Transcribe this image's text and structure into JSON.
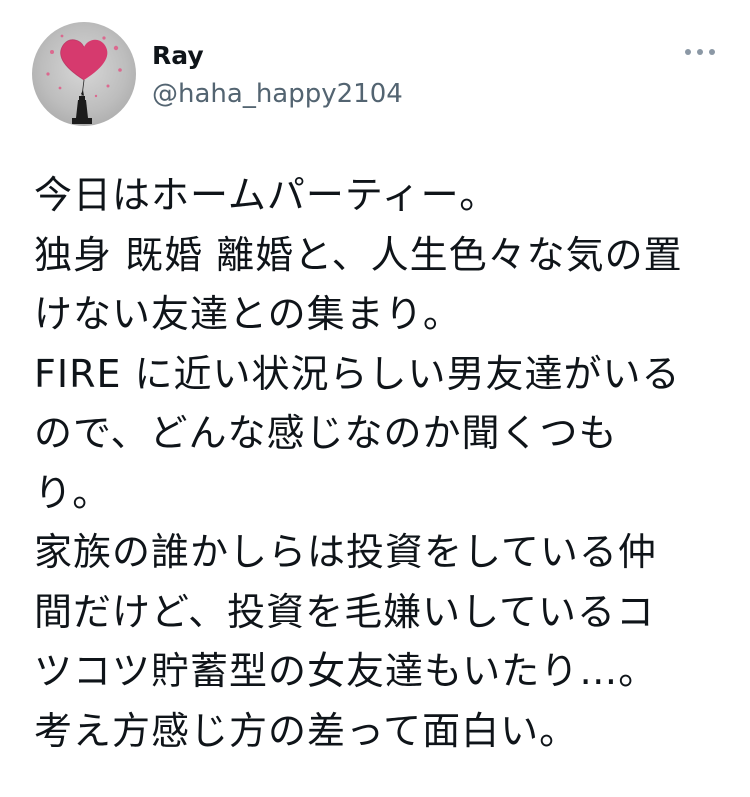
{
  "tweet": {
    "author": {
      "display_name": "Ray",
      "handle": "@haha_happy2104",
      "avatar_icon": "heart-balloon-statue-avatar"
    },
    "more_icon": "more-dots-icon",
    "text_lines": [
      "今日はホームパーティー。",
      "独身 既婚 離婚と、人生色々な気の置",
      "けない友達との集まり。",
      "FIRE に近い状況らしい男友達がいる",
      "ので、どんな感じなのか聞くつも",
      "り。",
      "家族の誰かしらは投資をしている仲",
      "間だけど、投資を毛嫌いしているコ",
      "ツコツ貯蓄型の女友達もいたり…。",
      "考え方感じ方の差って面白い。"
    ]
  },
  "colors": {
    "text": "#0f1419",
    "secondary": "#536471",
    "heart": "#d63a6e",
    "avatar_bg": "#bdbdbd"
  }
}
